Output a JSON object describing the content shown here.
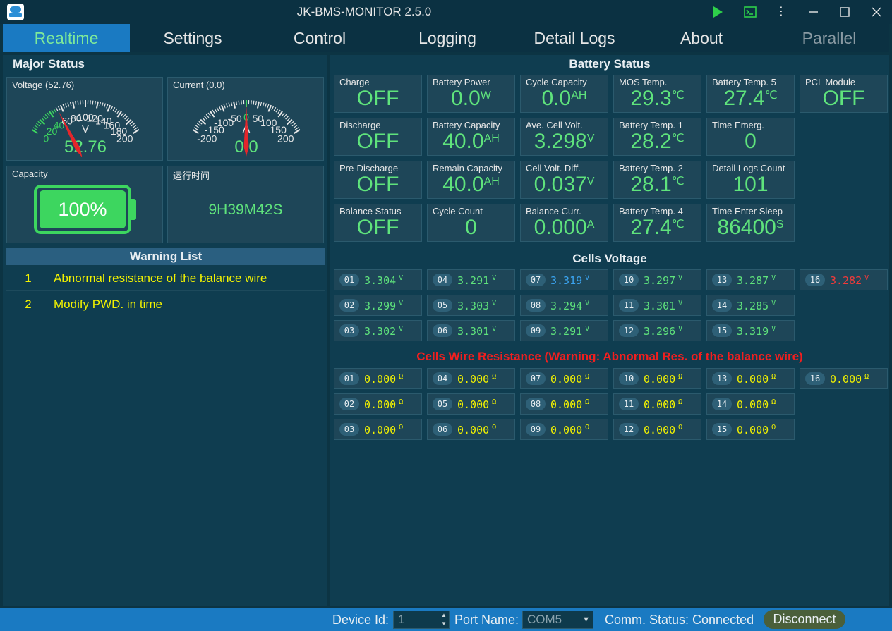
{
  "window": {
    "title": "JK-BMS-MONITOR 2.5.0"
  },
  "titlebar_icons": {
    "play": "play-icon",
    "terminal": "terminal-icon",
    "more": "more-icon",
    "minimize": "minimize-icon",
    "maximize": "maximize-icon",
    "close": "close-icon"
  },
  "tabs": [
    {
      "label": "Realtime",
      "active": true
    },
    {
      "label": "Settings"
    },
    {
      "label": "Control"
    },
    {
      "label": "Logging"
    },
    {
      "label": "Detail Logs"
    },
    {
      "label": "About"
    },
    {
      "label": "Parallel",
      "disabled": true
    }
  ],
  "major_status": {
    "title": "Major Status",
    "voltage": {
      "label": "Voltage (52.76)",
      "unit": "V",
      "value": 52.76,
      "display": "52.76",
      "min": 0,
      "max": 200,
      "ticks": [
        "0",
        "20",
        "40",
        "60",
        "80",
        "100",
        "120",
        "140",
        "160",
        "180",
        "200"
      ]
    },
    "current": {
      "label": "Current (0.0)",
      "unit": "A",
      "value": 0.0,
      "display": "0.0",
      "min": -200,
      "max": 200,
      "ticks": [
        "-200",
        "-150",
        "-100",
        "-50",
        "0",
        "50",
        "100",
        "150",
        "200"
      ]
    },
    "capacity": {
      "label": "Capacity",
      "value": "100%",
      "percent": 100
    },
    "runtime": {
      "label": "运行时间",
      "value": "9H39M42S"
    }
  },
  "warning_list": {
    "title": "Warning List",
    "items": [
      {
        "index": "1",
        "text": "Abnormal resistance of the balance wire"
      },
      {
        "index": "2",
        "text": "Modify PWD. in time"
      }
    ]
  },
  "battery_status": {
    "title": "Battery Status",
    "columns": [
      [
        {
          "label": "Charge",
          "value": "OFF",
          "unit": ""
        },
        {
          "label": "Discharge",
          "value": "OFF",
          "unit": ""
        },
        {
          "label": "Pre-Discharge",
          "value": "OFF",
          "unit": ""
        },
        {
          "label": "Balance Status",
          "value": "OFF",
          "unit": ""
        }
      ],
      [
        {
          "label": "Battery Power",
          "value": "0.0",
          "unit": "W"
        },
        {
          "label": "Battery Capacity",
          "value": "40.0",
          "unit": "AH"
        },
        {
          "label": "Remain Capacity",
          "value": "40.0",
          "unit": "AH"
        },
        {
          "label": "Cycle Count",
          "value": "0",
          "unit": ""
        }
      ],
      [
        {
          "label": "Cycle Capacity",
          "value": "0.0",
          "unit": "AH"
        },
        {
          "label": "Ave. Cell Volt.",
          "value": "3.298",
          "unit": "V"
        },
        {
          "label": "Cell Volt. Diff.",
          "value": "0.037",
          "unit": "V"
        },
        {
          "label": "Balance Curr.",
          "value": "0.000",
          "unit": "A"
        }
      ],
      [
        {
          "label": "MOS Temp.",
          "value": "29.3",
          "unit": "℃"
        },
        {
          "label": "Battery Temp. 1",
          "value": "28.2",
          "unit": "℃"
        },
        {
          "label": "Battery Temp. 2",
          "value": "28.1",
          "unit": "℃"
        },
        {
          "label": "Battery Temp. 4",
          "value": "27.4",
          "unit": "℃"
        }
      ],
      [
        {
          "label": "Battery Temp. 5",
          "value": "27.4",
          "unit": "℃"
        },
        {
          "label": "Time Emerg.",
          "value": "0",
          "unit": ""
        },
        {
          "label": "Detail Logs Count",
          "value": "101",
          "unit": ""
        },
        {
          "label": "Time Enter Sleep",
          "value": "86400",
          "unit": "S"
        }
      ],
      [
        {
          "label": "PCL Module",
          "value": "OFF",
          "unit": ""
        }
      ]
    ]
  },
  "cells_voltage": {
    "title": "Cells Voltage",
    "unit": "V",
    "cells": [
      {
        "no": "01",
        "value": "3.304",
        "color": "green"
      },
      {
        "no": "02",
        "value": "3.299",
        "color": "green"
      },
      {
        "no": "03",
        "value": "3.302",
        "color": "green"
      },
      {
        "no": "04",
        "value": "3.291",
        "color": "green"
      },
      {
        "no": "05",
        "value": "3.303",
        "color": "green"
      },
      {
        "no": "06",
        "value": "3.301",
        "color": "green"
      },
      {
        "no": "07",
        "value": "3.319",
        "color": "blue"
      },
      {
        "no": "08",
        "value": "3.294",
        "color": "green"
      },
      {
        "no": "09",
        "value": "3.291",
        "color": "green"
      },
      {
        "no": "10",
        "value": "3.297",
        "color": "green"
      },
      {
        "no": "11",
        "value": "3.301",
        "color": "green"
      },
      {
        "no": "12",
        "value": "3.296",
        "color": "green"
      },
      {
        "no": "13",
        "value": "3.287",
        "color": "green"
      },
      {
        "no": "14",
        "value": "3.285",
        "color": "green"
      },
      {
        "no": "15",
        "value": "3.319",
        "color": "green"
      },
      {
        "no": "16",
        "value": "3.282",
        "color": "red"
      }
    ]
  },
  "wire_resistance": {
    "title": "Cells Wire Resistance (Warning: Abnormal Res. of the balance wire)",
    "unit": "Ω",
    "cells": [
      {
        "no": "01",
        "value": "0.000"
      },
      {
        "no": "02",
        "value": "0.000"
      },
      {
        "no": "03",
        "value": "0.000"
      },
      {
        "no": "04",
        "value": "0.000"
      },
      {
        "no": "05",
        "value": "0.000"
      },
      {
        "no": "06",
        "value": "0.000"
      },
      {
        "no": "07",
        "value": "0.000"
      },
      {
        "no": "08",
        "value": "0.000"
      },
      {
        "no": "09",
        "value": "0.000"
      },
      {
        "no": "10",
        "value": "0.000"
      },
      {
        "no": "11",
        "value": "0.000"
      },
      {
        "no": "12",
        "value": "0.000"
      },
      {
        "no": "13",
        "value": "0.000"
      },
      {
        "no": "14",
        "value": "0.000"
      },
      {
        "no": "15",
        "value": "0.000"
      },
      {
        "no": "16",
        "value": "0.000"
      }
    ]
  },
  "statusbar": {
    "device_id_label": "Device Id:",
    "device_id_value": "1",
    "port_name_label": "Port Name:",
    "port_name_value": "COM5",
    "comm_status": "Comm. Status: Connected",
    "disconnect_label": "Disconnect"
  },
  "colors": {
    "accent": "#1a7ac2",
    "value_green": "#5fe37c",
    "warn_yellow": "#f2f200",
    "alert_red": "#f21f1f",
    "cell_blue": "#3ba4f0"
  }
}
